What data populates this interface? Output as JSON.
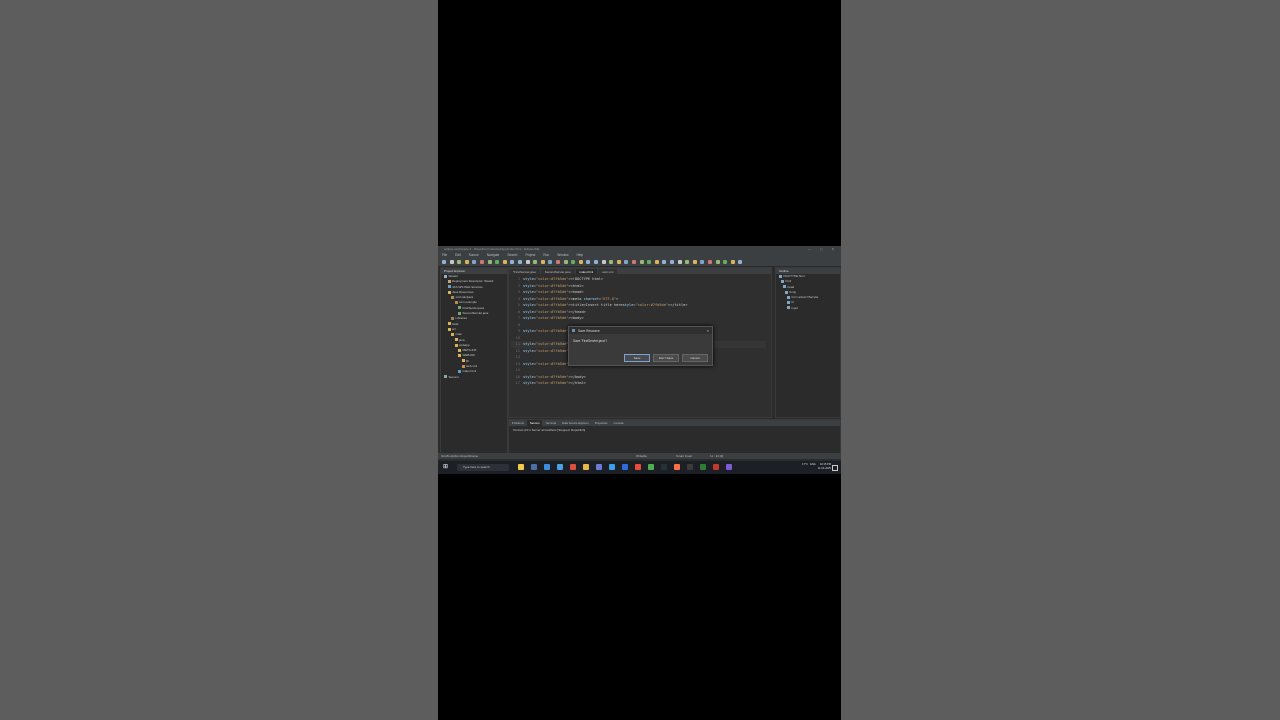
{
  "window": {
    "title": "eclipse-workspace-2 - Week2/src/main/webapp/index.html - Eclipse IDE",
    "controls": "—  ▢  ✕"
  },
  "menu": [
    "File",
    "Edit",
    "Source",
    "Navigate",
    "Search",
    "Project",
    "Run",
    "Window",
    "Help"
  ],
  "project_explorer": {
    "tab": "Project Explorer",
    "items": [
      {
        "label": "Week2",
        "depth": 0,
        "icon": "project-icon"
      },
      {
        "label": "Deployment Descriptor: Week2",
        "depth": 1,
        "icon": "descriptor-icon"
      },
      {
        "label": "JAX-WS Web Services",
        "depth": 1,
        "icon": "webservice-icon"
      },
      {
        "label": "Java Resources",
        "depth": 1,
        "icon": "folder-icon"
      },
      {
        "label": "src/main/java",
        "depth": 2,
        "icon": "package-icon"
      },
      {
        "label": "com.example",
        "depth": 3,
        "icon": "package-icon"
      },
      {
        "label": "FirstServlet.java",
        "depth": 4,
        "icon": "java-file-icon"
      },
      {
        "label": "SecondServlet.java",
        "depth": 4,
        "icon": "java-file-icon"
      },
      {
        "label": "Libraries",
        "depth": 2,
        "icon": "library-icon"
      },
      {
        "label": "build",
        "depth": 1,
        "icon": "folder-icon"
      },
      {
        "label": "src",
        "depth": 1,
        "icon": "folder-icon"
      },
      {
        "label": "main",
        "depth": 2,
        "icon": "folder-icon"
      },
      {
        "label": "java",
        "depth": 3,
        "icon": "folder-icon"
      },
      {
        "label": "webapp",
        "depth": 3,
        "icon": "folder-icon"
      },
      {
        "label": "META-INF",
        "depth": 4,
        "icon": "folder-icon"
      },
      {
        "label": "WEB-INF",
        "depth": 4,
        "icon": "folder-icon"
      },
      {
        "label": "lib",
        "depth": 5,
        "icon": "folder-icon"
      },
      {
        "label": "web.xml",
        "depth": 5,
        "icon": "xml-file-icon"
      },
      {
        "label": "index.html",
        "depth": 4,
        "icon": "html-file-icon"
      },
      {
        "label": "Servers",
        "depth": 0,
        "icon": "server-icon"
      }
    ]
  },
  "editor": {
    "tabs": [
      "*FirstServlet.java",
      "SecondServlet.java",
      "index.html",
      "web.xml"
    ],
    "active_tab": 2,
    "lines": [
      {
        "n": "1",
        "text": "<!DOCTYPE html>"
      },
      {
        "n": "2",
        "text": "<html>"
      },
      {
        "n": "3",
        "text": "<head>"
      },
      {
        "n": "4",
        "text": "<meta charset=\"UTF-8\">"
      },
      {
        "n": "5",
        "text": "<title>Insert title here</title>"
      },
      {
        "n": "6",
        "text": "</head>"
      },
      {
        "n": "7",
        "text": "<body>"
      },
      {
        "n": "8",
        "text": ""
      },
      {
        "n": "9",
        "text": "<form action=\"/i"
      },
      {
        "n": "10",
        "text": ""
      },
      {
        "n": "11",
        "text": "<input type=\"tex"
      },
      {
        "n": "12",
        "text": "<input type=\"sub"
      },
      {
        "n": "13",
        "text": ""
      },
      {
        "n": "14",
        "text": "</form>"
      },
      {
        "n": "15",
        "text": ""
      },
      {
        "n": "16",
        "text": "</body>"
      },
      {
        "n": "17",
        "text": "</html>"
      }
    ]
  },
  "outline": {
    "tab": "Outline",
    "items": [
      "DOCTYPE:html",
      "html",
      "head",
      "body",
      "form action=/Servlet",
      "br",
      "input"
    ]
  },
  "bottom_panel": {
    "tabs": [
      "Problems",
      "Servers",
      "Terminal",
      "Data Source Explorer",
      "Properties",
      "Console"
    ],
    "active_tab": 1,
    "row": "Tomcat v10.1 Server at localhost [Stopped, Republish]"
  },
  "status": {
    "path": "html/body/form/input/#name",
    "writable": "Writable",
    "insert": "Smart Insert",
    "position": "11 : 24 [2]"
  },
  "dialog": {
    "title": "Save Resource",
    "message": "Save 'FirstServlet.java'?",
    "buttons": [
      "Save",
      "Don't Save",
      "Cancel"
    ]
  },
  "taskbar": {
    "search_placeholder": "Type here to search",
    "weather": "17°C",
    "lang": "ENG",
    "time": "02:15 PM",
    "date": "11-01-2025"
  },
  "colors": {
    "keyword": "#4ea1d3",
    "attr": "#9cdcfe",
    "string": "#c9a26d",
    "text": "#d4d4d4",
    "tag": "#7fb5de"
  }
}
